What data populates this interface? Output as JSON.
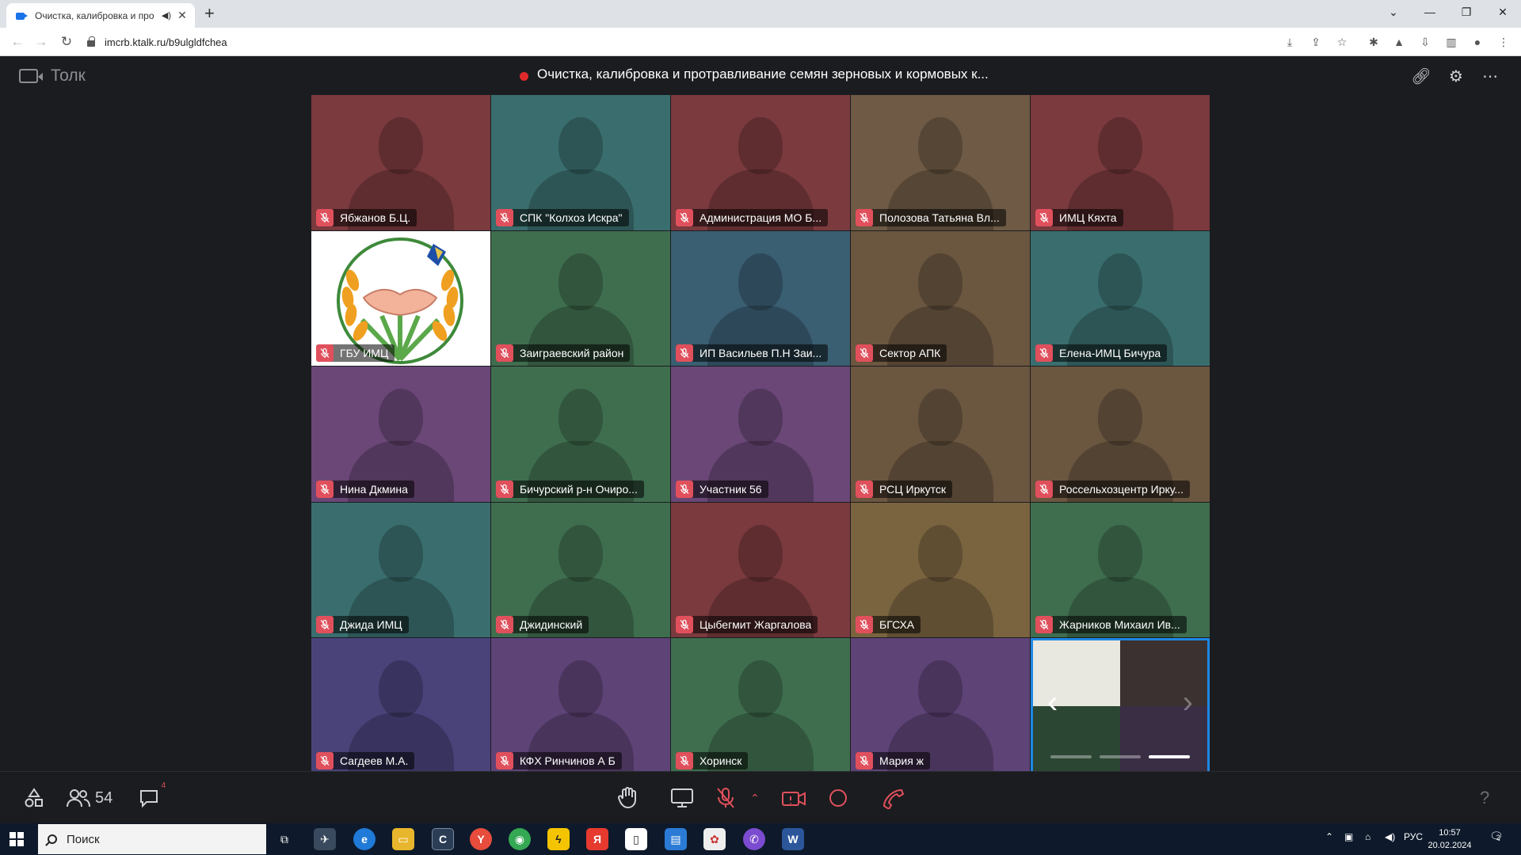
{
  "browser": {
    "tab_title": "Очистка, калибровка и про",
    "url": "imcrb.ktalk.ru/b9ulgldfchea"
  },
  "app": {
    "name": "Толк",
    "meeting_title": "Очистка, калибровка и протравливание семян зерновых и кормовых к...",
    "participants_count": "54",
    "chat_badge": "4"
  },
  "tiles": [
    {
      "name": "Ябжанов Б.Ц.",
      "color": "#7a3a3e"
    },
    {
      "name": "СПК \"Колхоз Искра\"",
      "color": "#3a6e6e"
    },
    {
      "name": "Администрация МО Б...",
      "color": "#7a3a3e"
    },
    {
      "name": "Полозова Татьяна Вл...",
      "color": "#6e5a45"
    },
    {
      "name": "ИМЦ Кяхта",
      "color": "#7a3a3e"
    },
    {
      "name": "ГБУ ИМЦ",
      "color": "#ffffff",
      "logo": true
    },
    {
      "name": "Заиграевский район",
      "color": "#3f6e4f"
    },
    {
      "name": "ИП Васильев П.Н Заи...",
      "color": "#3a5e72"
    },
    {
      "name": "Сектор АПК",
      "color": "#6b5640"
    },
    {
      "name": "Елена-ИМЦ Бичура",
      "color": "#3a6e6e"
    },
    {
      "name": "Нина Дкмина",
      "color": "#6a4777"
    },
    {
      "name": "Бичурский р-н Очиро...",
      "color": "#3f6e4f"
    },
    {
      "name": "Участник 56",
      "color": "#6a4777"
    },
    {
      "name": "РСЦ Иркутск",
      "color": "#6b5640"
    },
    {
      "name": "Россельхозцентр Ирку...",
      "color": "#6b5640"
    },
    {
      "name": "Джида ИМЦ",
      "color": "#3a6e6e"
    },
    {
      "name": "Джидинский",
      "color": "#3f6e4f"
    },
    {
      "name": "Цыбегмит Жаргалова",
      "color": "#7a3a3e"
    },
    {
      "name": "БГСХА",
      "color": "#7a6440"
    },
    {
      "name": "Жарников Михаил Ив...",
      "color": "#3f6e4f"
    },
    {
      "name": "Сагдеев М.А.",
      "color": "#4a437a"
    },
    {
      "name": "КФХ Ринчинов А Б",
      "color": "#5e4377"
    },
    {
      "name": "Хоринск",
      "color": "#3f6e4f"
    },
    {
      "name": "Мария ж",
      "color": "#5e4377"
    }
  ],
  "taskbar": {
    "search_label": "Поиск",
    "lang": "РУС",
    "time": "10:57",
    "date": "20.02.2024",
    "notif_count": "2"
  }
}
